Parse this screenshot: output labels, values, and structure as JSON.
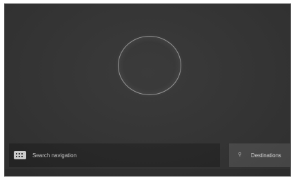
{
  "search": {
    "label": "Search navigation",
    "icon": "keyboard-icon"
  },
  "destinations": {
    "label": "Destinations",
    "icon": "pin-icon",
    "glyph": "⚲"
  },
  "colors": {
    "background": "#333333",
    "search_bar": "#262626",
    "button": "#4a4a4a"
  }
}
